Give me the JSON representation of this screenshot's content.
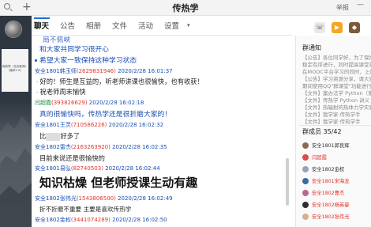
{
  "titlebar": {
    "title": "传热学",
    "edit_icon": "pencil-icon",
    "report": "举报",
    "plus": "+"
  },
  "sidebar": {
    "group_card_label": "传热学（王光老师）（版本1 0）"
  },
  "tabs": [
    {
      "label": "聊天",
      "active": true
    },
    {
      "label": "公告"
    },
    {
      "label": "相册"
    },
    {
      "label": "文件"
    },
    {
      "label": "活动"
    },
    {
      "label": "设置"
    }
  ],
  "chat": {
    "cut_line": "局不佩峡",
    "line1": "和大家共同学习很开心",
    "line2": "希望大家一致保持这种学习状态",
    "m1": {
      "name": "安全1801韩玉师",
      "qq": "(2629831946)",
      "time": "2020/2/28 16:01:37"
    },
    "m1_text": "好的！师生是互益的，听老师讲课也很愉快，也有收获！",
    "m1_text2": "祝老师周末愉快",
    "m2": {
      "name": "闫超霞",
      "qq": "(393826629)",
      "time": "2020/2/28 16:02:18"
    },
    "m2_text": "真的很愉快吗，传热学还是很折磨大家的！",
    "m3": {
      "name": "安全1801王灵",
      "qq": "(710586226)",
      "time": "2020/2/28 16:02:32"
    },
    "m3_text": "比",
    "m3_text2": "好多了",
    "m4": {
      "name": "安全1802雷杰",
      "qq": "(2163263920)",
      "time": "2020/2/28 16:02:35"
    },
    "m4_text": "目前来说还是很愉快的",
    "m5": {
      "name": "安全1801易弘",
      "qq": "(82740503)",
      "time": "2020/2/28 16:02:44"
    },
    "m5_text": "知识枯燥 但老师授课生动有趣",
    "m6": {
      "name": "安全1802张伟光",
      "qq": "(1543806500)",
      "time": "2020/2/28 16:02:49"
    },
    "m6_text": "折不折磨不重要 主要是喜欢传热学",
    "m7": {
      "name": "安全1802金权",
      "qq": "(3441074289)",
      "time": "2020/2/28 16:02:50"
    }
  },
  "right_panel": {
    "notice_title": "群通知",
    "notices": [
      "【公告】各位同学好，为了保持",
      "稳定有序进行，同时提高课堂效率",
      "在MOOC平台学习的同时，上课时",
      "【公告】学习资源分享，请大家",
      "期间使用QQ\"群课堂\"功能进行",
      "【文件】案办法学 Python（第2",
      "【文件】传热学 Python 讲义",
      "【文件】热辐射的热体力学实验",
      "【文件】我学家·传热学手",
      "【文件】我学家·传热学手"
    ],
    "members_title": "群成员 35/42",
    "members": [
      {
        "name": "安全1801郭良辉",
        "color": "#333"
      },
      {
        "name": "闫超霞",
        "color": "#e0352b"
      },
      {
        "name": "安全1802金权",
        "color": "#333"
      },
      {
        "name": "安全1801宋海龙",
        "color": "#e0352b"
      },
      {
        "name": "安全1802曹杰",
        "color": "#e0352b"
      },
      {
        "name": "安全1802杨英豪",
        "color": "#e0352b"
      },
      {
        "name": "安全1802张伟光",
        "color": "#e0352b"
      }
    ]
  },
  "colors": {
    "link_blue": "#1b4fb3",
    "name_red": "#e0352b",
    "accent": "#1e6fe0",
    "sidebar_dark": "#2d3540"
  }
}
